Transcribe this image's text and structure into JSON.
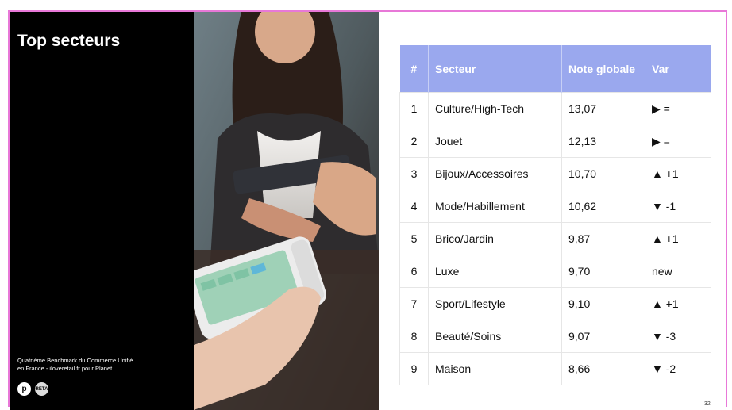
{
  "slide": {
    "title": "Top secteurs",
    "credit_line1": "Quatrième Benchmark du Commerce Unifié",
    "credit_line2": "en France - iloveretail.fr pour Planet",
    "logo1": "p",
    "logo2": "I♥RETAIL",
    "page_number": "32"
  },
  "table": {
    "headers": [
      "#",
      "Secteur",
      "Note globale",
      "Var"
    ],
    "rows": [
      {
        "rank": "1",
        "sector": "Culture/High-Tech",
        "score": "13,07",
        "var_symbol": "▶",
        "var_text": "=",
        "var_type": "eq"
      },
      {
        "rank": "2",
        "sector": "Jouet",
        "score": "12,13",
        "var_symbol": "▶",
        "var_text": "=",
        "var_type": "eq"
      },
      {
        "rank": "3",
        "sector": "Bijoux/Accessoires",
        "score": "10,70",
        "var_symbol": "▲",
        "var_text": "+1",
        "var_type": "up"
      },
      {
        "rank": "4",
        "sector": "Mode/Habillement",
        "score": "10,62",
        "var_symbol": "▼",
        "var_text": "-1",
        "var_type": "down"
      },
      {
        "rank": "5",
        "sector": "Brico/Jardin",
        "score": "9,87",
        "var_symbol": "▲",
        "var_text": "+1",
        "var_type": "up"
      },
      {
        "rank": "6",
        "sector": "Luxe",
        "score": "9,70",
        "var_symbol": "",
        "var_text": "new",
        "var_type": "new"
      },
      {
        "rank": "7",
        "sector": "Sport/Lifestyle",
        "score": "9,10",
        "var_symbol": "▲",
        "var_text": "+1",
        "var_type": "up"
      },
      {
        "rank": "8",
        "sector": "Beauté/Soins",
        "score": "9,07",
        "var_symbol": "▼",
        "var_text": "-3",
        "var_type": "down"
      },
      {
        "rank": "9",
        "sector": "Maison",
        "score": "8,66",
        "var_symbol": "▼",
        "var_text": "-2",
        "var_type": "down"
      }
    ]
  },
  "colors": {
    "header_bg": "#9aa8ee",
    "up": "#7f8be3",
    "down": "#e0147d",
    "neutral": "#9a9a9a",
    "frame": "#e878d8"
  }
}
